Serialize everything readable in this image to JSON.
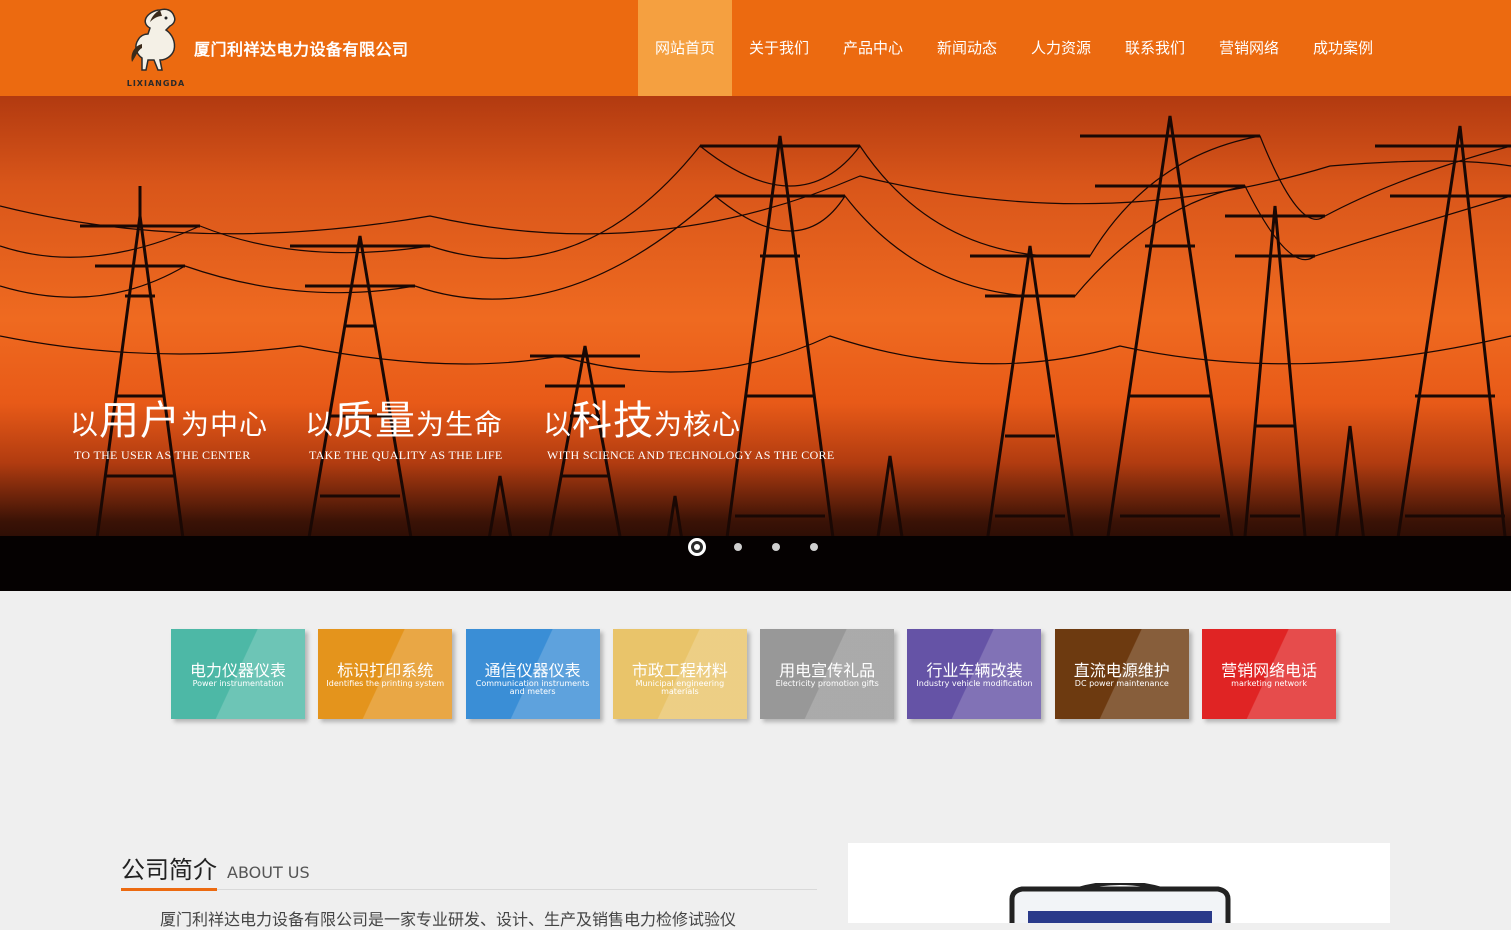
{
  "header": {
    "logo_text": "LIXIANGDA",
    "company_name": "厦门利祥达电力设备有限公司"
  },
  "nav": [
    {
      "label": "网站首页",
      "active": true
    },
    {
      "label": "关于我们"
    },
    {
      "label": "产品中心"
    },
    {
      "label": "新闻动态"
    },
    {
      "label": "人力资源"
    },
    {
      "label": "联系我们"
    },
    {
      "label": "营销网络"
    },
    {
      "label": "成功案例"
    }
  ],
  "banner": {
    "slogans": [
      {
        "prefix": "以",
        "big": "用户",
        "suffix": "为中心",
        "en": "TO THE USER AS THE CENTER"
      },
      {
        "prefix": "以",
        "big": "质量",
        "suffix": "为生命",
        "en": "TAKE THE QUALITY AS THE LIFE"
      },
      {
        "prefix": "以",
        "big": "科技",
        "suffix": "为核心",
        "en": "WITH SCIENCE AND TECHNOLOGY AS THE CORE"
      }
    ],
    "slide_count": 4,
    "active_slide": 1
  },
  "services": [
    {
      "cn": "电力仪器仪表",
      "en": "Power instrumentation",
      "color": "#4db8a6"
    },
    {
      "cn": "标识打印系统",
      "en": "Identifies the printing system",
      "color": "#e4941c"
    },
    {
      "cn": "通信仪器仪表",
      "en": "Communication instruments and meters",
      "color": "#3a8ed6"
    },
    {
      "cn": "市政工程材料",
      "en": "Municipal engineering materials",
      "color": "#e9c46a"
    },
    {
      "cn": "用电宣传礼品",
      "en": "Electricity promotion gifts",
      "color": "#989898"
    },
    {
      "cn": "行业车辆改装",
      "en": "Industry vehicle modification",
      "color": "#6553a6"
    },
    {
      "cn": "直流电源维护",
      "en": "DC power maintenance",
      "color": "#6d3a10"
    },
    {
      "cn": "营销网络电话",
      "en": "marketing network",
      "color": "#e02424"
    }
  ],
  "about": {
    "title_cn": "公司简介",
    "title_en": "ABOUT US",
    "text": "厦门利祥达电力设备有限公司是一家专业研发、设计、生产及销售电力检修试验仪"
  },
  "colors": {
    "header_bg": "#ec6a10",
    "nav_active_bg": "#f5a040",
    "accent": "#ec6a10"
  }
}
